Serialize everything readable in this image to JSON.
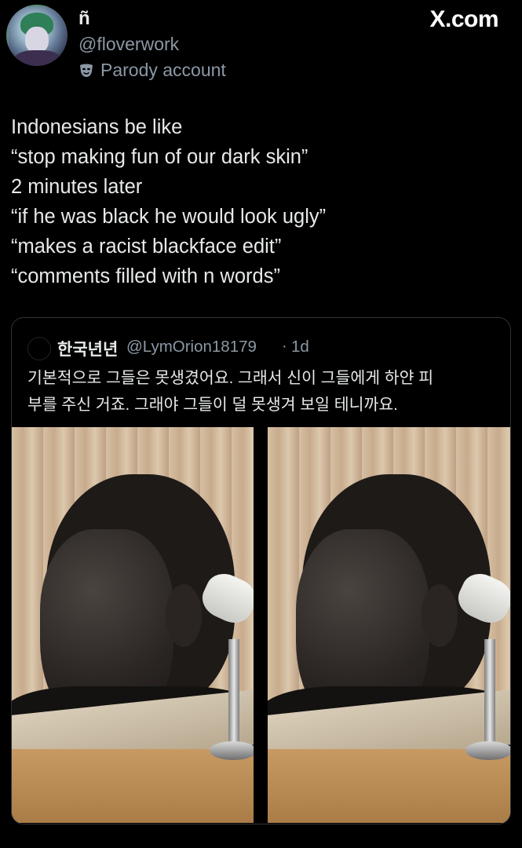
{
  "author": {
    "display_name": "ñ",
    "handle": "@floverwork",
    "badge_label": "Parody account",
    "badge_icon": "mask-icon"
  },
  "site_label": "X.com",
  "tweet": {
    "lines": [
      "Indonesians be like",
      "“stop making fun of our dark skin”",
      "2 minutes later",
      "“if he was black he would look ugly”",
      "“makes a racist blackface edit”",
      "“comments filled with n words”"
    ]
  },
  "quote": {
    "name": "한국년년",
    "handle": "@LymOrion18179",
    "separator": "·",
    "time": "1d",
    "lines": [
      "기본적으로 그들은 못생겼어요. 그래서 신이 그들에게 하얀 피",
      "부를 주신 거죠. 그래야 그들이 덜 못생겨 보일 테니까요."
    ]
  },
  "colors": {
    "background": "#000000",
    "text_primary": "#e7e9ea",
    "text_secondary": "#8b98a5",
    "card_border": "#2f3336"
  }
}
